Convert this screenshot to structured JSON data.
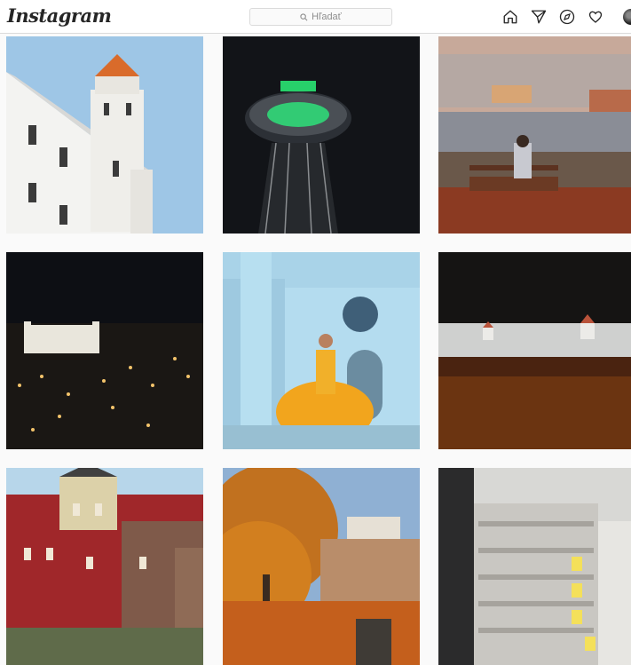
{
  "header": {
    "logo": "Instagram",
    "search_placeholder": "Hľadať",
    "icons": [
      "home-icon",
      "direct-send-icon",
      "explore-compass-icon",
      "activity-heart-icon",
      "profile-avatar"
    ]
  },
  "grid": {
    "posts": [
      {
        "subject": "castle-tower-orange-roof"
      },
      {
        "subject": "ufo-bridge-tower-green-lights"
      },
      {
        "subject": "person-on-bench-riverside-castle"
      },
      {
        "subject": "castle-night-city-lights"
      },
      {
        "subject": "blue-church-yellow-dress"
      },
      {
        "subject": "castle-above-fog"
      },
      {
        "subject": "red-ivy-building"
      },
      {
        "subject": "autumn-tree-castle-view"
      },
      {
        "subject": "modern-apartment-building"
      }
    ]
  },
  "colors": {
    "background": "#fafafa",
    "border": "#dbdbdb",
    "text_muted": "#8e8e8e",
    "text_dark": "#262626"
  }
}
